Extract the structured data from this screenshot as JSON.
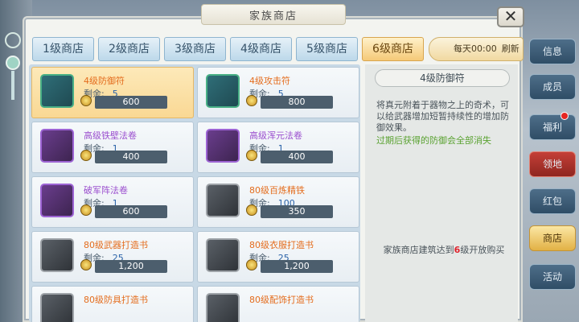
{
  "window": {
    "title": "家族商店",
    "close_label": "✕"
  },
  "tabs": [
    {
      "label": "1级商店"
    },
    {
      "label": "2级商店"
    },
    {
      "label": "3级商店"
    },
    {
      "label": "4级商店"
    },
    {
      "label": "5级商店"
    },
    {
      "label": "6级商店",
      "active": true
    }
  ],
  "refresh": {
    "time": "每天00:00",
    "label": "刷新"
  },
  "items": [
    {
      "name": "4级防御符",
      "remain_label": "剩余:",
      "remain": "5",
      "price": "600",
      "selected": true,
      "color": "orange",
      "icon": "defense-talisman-icon"
    },
    {
      "name": "4级攻击符",
      "remain_label": "剩余:",
      "remain": "5",
      "price": "800",
      "color": "orange",
      "icon": "attack-talisman-icon"
    },
    {
      "name": "高级铁壁法卷",
      "remain_label": "剩余:",
      "remain": "1",
      "price": "400",
      "color": "purple",
      "icon": "scroll-icon"
    },
    {
      "name": "高级浑元法卷",
      "remain_label": "剩余:",
      "remain": "1",
      "price": "400",
      "color": "purple",
      "icon": "scroll-icon"
    },
    {
      "name": "破军阵法卷",
      "remain_label": "剩余:",
      "remain": "1",
      "price": "600",
      "color": "purple",
      "icon": "scroll-icon"
    },
    {
      "name": "80级百炼精铁",
      "remain_label": "剩余:",
      "remain": "100",
      "price": "350",
      "color": "orange",
      "icon": "iron-ore-icon"
    },
    {
      "name": "80级武器打造书",
      "remain_label": "剩余:",
      "remain": "25",
      "price": "1,200",
      "color": "orange",
      "icon": "book-icon"
    },
    {
      "name": "80级衣服打造书",
      "remain_label": "剩余:",
      "remain": "25",
      "price": "1,200",
      "color": "orange",
      "icon": "book-icon"
    },
    {
      "name": "80级防具打造书",
      "color": "orange",
      "icon": "book-icon"
    },
    {
      "name": "80级配饰打造书",
      "color": "orange",
      "icon": "book-icon"
    }
  ],
  "detail": {
    "title": "4级防御符",
    "description": "将真元附着于器物之上的奇术，可以给武器增加短暂持续性的增加防御效果。",
    "note": "过期后获得的防御会全部消失",
    "condition_prefix": "家族商店建筑达到",
    "condition_level": "6",
    "condition_suffix": "级开放购买"
  },
  "side_menu": [
    {
      "label": "信息"
    },
    {
      "label": "成员"
    },
    {
      "label": "福利",
      "dot": true
    },
    {
      "label": "领地",
      "style": "red"
    },
    {
      "label": "红包"
    },
    {
      "label": "商店",
      "active": true
    },
    {
      "label": "活动"
    }
  ]
}
